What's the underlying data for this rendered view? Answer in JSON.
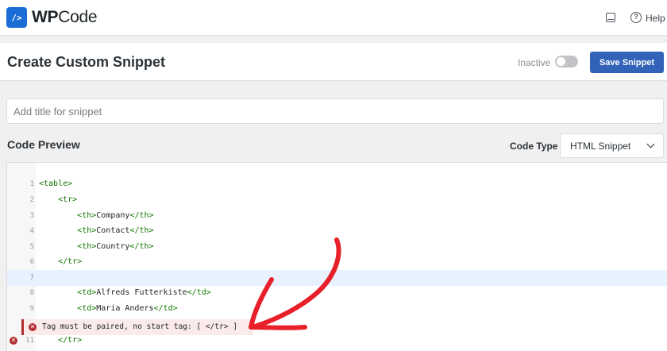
{
  "app": {
    "logo_mark": "/>",
    "logo_bold": "WP",
    "logo_rest": "Code",
    "help_label": "Help"
  },
  "header": {
    "title": "Create Custom Snippet",
    "status_label": "Inactive",
    "active": false,
    "save_label": "Save Snippet"
  },
  "title_input": {
    "placeholder": "Add title for snippet",
    "value": ""
  },
  "code_preview": {
    "label": "Code Preview",
    "code_type_label": "Code Type",
    "code_type_value": "HTML Snippet",
    "active_line": 7,
    "lines": [
      {
        "no": "1",
        "text": "<table>"
      },
      {
        "no": "2",
        "text": "    <tr>"
      },
      {
        "no": "3",
        "text": "        <th>Company</th>"
      },
      {
        "no": "4",
        "text": "        <th>Contact</th>"
      },
      {
        "no": "5",
        "text": "        <th>Country</th>"
      },
      {
        "no": "6",
        "text": "    </tr>"
      },
      {
        "no": "7",
        "text": ""
      },
      {
        "no": "8",
        "text": "        <td>Alfreds Futterkiste</td>"
      },
      {
        "no": "9",
        "text": "        <td>Maria Anders</td>"
      },
      {
        "no": "11",
        "text": "    </tr>"
      }
    ],
    "error": {
      "icon": "error-circle-icon",
      "message": "Tag must be paired, no start tag: [ </tr> ]"
    }
  },
  "colors": {
    "brand": "#1a6cd6",
    "save_button": "#3363b8",
    "tag": "#117700",
    "error": "#b32d2e",
    "arrow": "#e8202a"
  }
}
